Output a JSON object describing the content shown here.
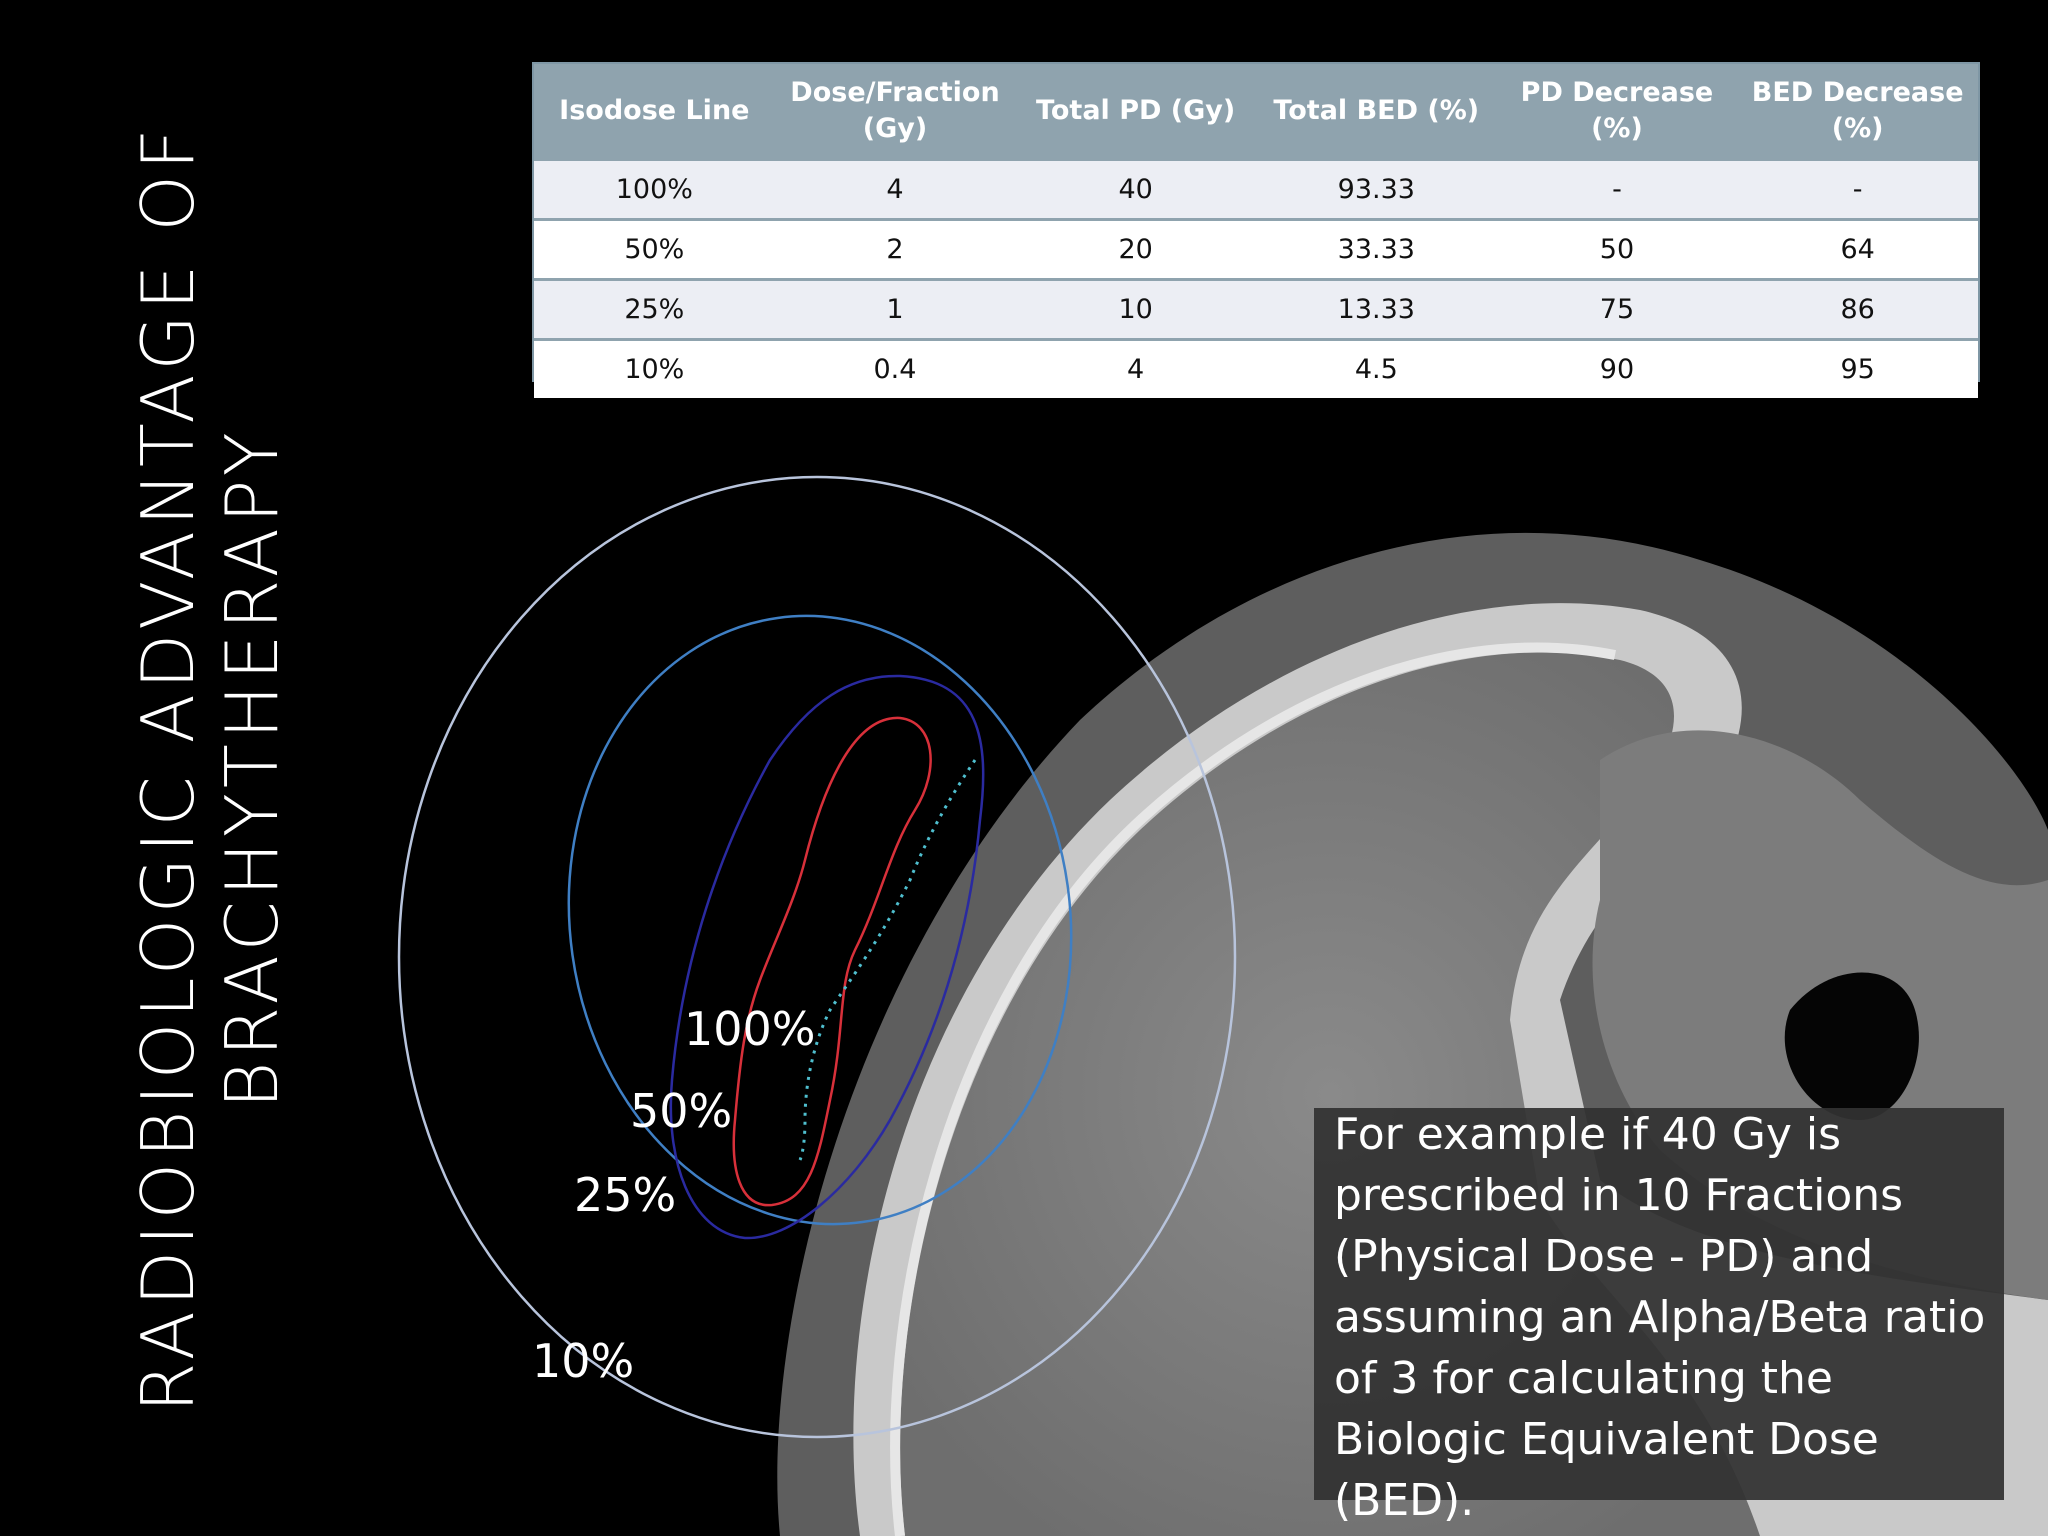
{
  "slide": {
    "title_line1": "RADIOBIOLOGIC ADVANTAGE OF",
    "title_line2": "BRACHYTHERAPY"
  },
  "table": {
    "headers": [
      "Isodose Line",
      "Dose/Fraction (Gy)",
      "Total PD (Gy)",
      "Total BED (%)",
      "PD Decrease (%)",
      "BED Decrease (%)"
    ],
    "rows": [
      [
        "100%",
        "4",
        "40",
        "93.33",
        "-",
        "-"
      ],
      [
        "50%",
        "2",
        "20",
        "33.33",
        "50",
        "64"
      ],
      [
        "25%",
        "1",
        "10",
        "13.33",
        "75",
        "86"
      ],
      [
        "10%",
        "0.4",
        "4",
        "4.5",
        "90",
        "95"
      ]
    ]
  },
  "isodose_labels": {
    "l100": "100%",
    "l50": "50%",
    "l25": "25%",
    "l10": "10%"
  },
  "isodose_colors": {
    "iso_100": "#d8303a",
    "iso_50": "#2a2aa0",
    "iso_25": "#3f7fc4",
    "iso_10": "#b8c4dc",
    "applicator": "#4fbfcf"
  },
  "example_text": "For example if 40 Gy is prescribed in 10 Fractions (Physical Dose - PD) and assuming an Alpha/Beta ratio of 3 for calculating the Biologic Equivalent Dose (BED)."
}
